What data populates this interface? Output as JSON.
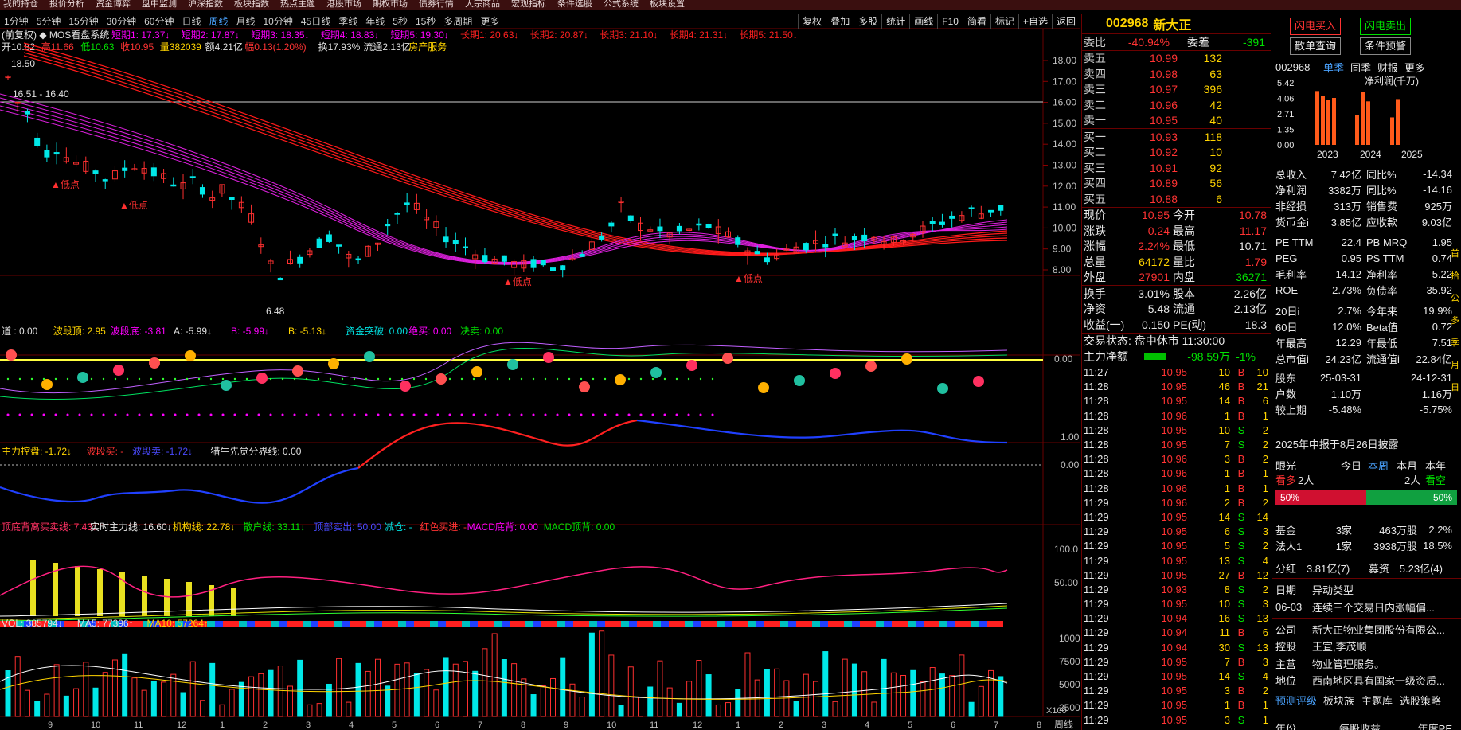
{
  "top_menu": [
    "我的持仓",
    "投价分析",
    "资金博弈",
    "盘中监测",
    "沪深指数",
    "板块指数",
    "热点主题",
    "港股市场",
    "期权市场",
    "债券行情",
    "大宗商品",
    "宏观指标",
    "条件选股",
    "公式系统",
    "板块设置"
  ],
  "periods": [
    "1分钟",
    "5分钟",
    "15分钟",
    "30分钟",
    "60分钟",
    "日线",
    "周线",
    "月线",
    "10分钟",
    "45日线",
    "季线",
    "年线",
    "5秒",
    "15秒",
    "多周期",
    "更多"
  ],
  "selected_period": "周线",
  "tools": [
    "复权",
    "叠加",
    "多股",
    "统计",
    "画线",
    "F10",
    "简看",
    "标记",
    "+自选",
    "返回"
  ],
  "chart": {
    "title_line": "(前复权) ◆ MOS看盘系统",
    "mas": [
      {
        "t": "短期1: 17.37↓",
        "c": "#ff00ff"
      },
      {
        "t": "短期2: 17.87↓",
        "c": "#ff00ff"
      },
      {
        "t": "短期3: 18.35↓",
        "c": "#ff00ff"
      },
      {
        "t": "短期4: 18.83↓",
        "c": "#ff00ff"
      },
      {
        "t": "短期5: 19.30↓",
        "c": "#ff00ff"
      },
      {
        "t": "长期1: 20.63↓",
        "c": "#ff2020"
      },
      {
        "t": "长期2: 20.87↓",
        "c": "#ff2020"
      },
      {
        "t": "长期3: 21.10↓",
        "c": "#ff2020"
      },
      {
        "t": "长期4: 21.31↓",
        "c": "#ff2020"
      },
      {
        "t": "长期5: 21.50↓",
        "c": "#ff2020"
      }
    ],
    "ohlc_line": [
      {
        "t": "开10.82 ",
        "c": "#e0e0e0"
      },
      {
        "t": "高11.66 ",
        "c": "#ff3333"
      },
      {
        "t": "低10.63 ",
        "c": "#00e000"
      },
      {
        "t": "收10.95 ",
        "c": "#ff3333"
      },
      {
        "t": "量382039 ",
        "c": "#ffd400"
      },
      {
        "t": "额4.21亿 ",
        "c": "#e0e0e0"
      },
      {
        "t": "幅0.13(1.20%) ",
        "c": "#ff3333"
      },
      {
        "t": "换17.93% ",
        "c": "#e0e0e0"
      },
      {
        "t": "流通2.13亿 ",
        "c": "#e0e0e0"
      },
      {
        "t": "房产服务",
        "c": "#ffd400"
      }
    ],
    "price_axis": [
      "18.00",
      "17.00",
      "16.00",
      "15.00",
      "14.00",
      "13.00",
      "12.00",
      "11.00",
      "10.00",
      "9.00",
      "8.00"
    ],
    "labels": {
      "high": "18.50",
      "range": "16.51 - 16.40",
      "low": "6.48",
      "dp1": "▲低点",
      "dp2": "▲低点",
      "dp3": "▲低点",
      "dp4": "▲低点",
      "dp5": "▲低点"
    },
    "ind1": [
      {
        "t": "道 : 0.00 ",
        "c": "#e0e0e0"
      },
      {
        "t": "波段顶: 2.95 ",
        "c": "#ffd400"
      },
      {
        "t": "波段底: -3.81 ",
        "c": "#ff00ff"
      },
      {
        "t": "A: -5.99↓ ",
        "c": "#e0e0e0"
      },
      {
        "t": "B: -5.99↓ ",
        "c": "#ff00ff"
      },
      {
        "t": "B: -5.13↓ ",
        "c": "#ffd400"
      },
      {
        "t": "资金突破: 0.00 ",
        "c": "#00e0e0"
      },
      {
        "t": "绝买: 0.00 ",
        "c": "#ff00ff"
      },
      {
        "t": "决卖: 0.00",
        "c": "#00e000"
      }
    ],
    "ind1_axis": "0.00",
    "ind2": [
      {
        "t": "主力控盘: -1.72↓ ",
        "c": "#ffd400"
      },
      {
        "t": "波段买: - ",
        "c": "#ff3333"
      },
      {
        "t": "波段卖: -1.72↓ ",
        "c": "#4a4aff"
      },
      {
        "t": "猎牛先觉分界线: 0.00",
        "c": "#e0e0e0"
      }
    ],
    "ind2_axis": [
      "1.00",
      "0.00"
    ],
    "ind3": [
      {
        "t": "顶底背离买卖线: 7.43↓ ",
        "c": "#ff3366"
      },
      {
        "t": "实时主力线: 16.60↓ ",
        "c": "#e8e8e8"
      },
      {
        "t": "机构线: 22.78↓ ",
        "c": "#ffd400"
      },
      {
        "t": "散户线: 33.11↓ ",
        "c": "#00e000"
      },
      {
        "t": "顶部卖出: 50.00 ",
        "c": "#4a4aff"
      },
      {
        "t": "减仓: - ",
        "c": "#00e0e0"
      },
      {
        "t": "红色买进: - ",
        "c": "#ff3333"
      },
      {
        "t": "MACD底背: 0.00 ",
        "c": "#ff00ff"
      },
      {
        "t": "MACD顶背: 0.00",
        "c": "#00e000"
      }
    ],
    "ind3_axis": [
      "100.0",
      "50.00"
    ],
    "vol": [
      {
        "t": "VOL: 385794↓ ",
        "c": "#e0e0e0"
      },
      {
        "t": "MA5: 77396↑ ",
        "c": "#e0e0e0"
      },
      {
        "t": "MA10: 57264↑",
        "c": "#ffd400"
      }
    ],
    "vol_axis": [
      "10000",
      "7500",
      "5000",
      "2500"
    ],
    "vol_unit": "X100",
    "xdates": [
      "9",
      "10",
      "11",
      "12",
      "1",
      "2",
      "3",
      "4",
      "5",
      "6",
      "7",
      "8",
      "9",
      "10",
      "11",
      "12",
      "1",
      "2",
      "3",
      "4",
      "5",
      "6",
      "7",
      "8"
    ],
    "x_label": "周线"
  },
  "quote": {
    "code": "002968",
    "name": "新大正",
    "wb": {
      "label": "委比",
      "val": "-40.94%",
      "label2": "委差",
      "val2": "-391"
    },
    "asks": [
      {
        "l": "卖五",
        "p": "10.99",
        "v": "132"
      },
      {
        "l": "卖四",
        "p": "10.98",
        "v": "63"
      },
      {
        "l": "卖三",
        "p": "10.97",
        "v": "396"
      },
      {
        "l": "卖二",
        "p": "10.96",
        "v": "42"
      },
      {
        "l": "卖一",
        "p": "10.95",
        "v": "40"
      }
    ],
    "bids": [
      {
        "l": "买一",
        "p": "10.93",
        "v": "118"
      },
      {
        "l": "买二",
        "p": "10.92",
        "v": "10"
      },
      {
        "l": "买三",
        "p": "10.91",
        "v": "92"
      },
      {
        "l": "买四",
        "p": "10.89",
        "v": "56"
      },
      {
        "l": "买五",
        "p": "10.88",
        "v": "6"
      }
    ],
    "stats": [
      [
        {
          "t": "现价",
          "c": "wht"
        },
        {
          "t": "10.95",
          "c": "red"
        },
        {
          "t": "今开",
          "c": "wht"
        },
        {
          "t": "10.78",
          "c": "red"
        }
      ],
      [
        {
          "t": "涨跌",
          "c": "wht"
        },
        {
          "t": "0.24",
          "c": "red"
        },
        {
          "t": "最高",
          "c": "wht"
        },
        {
          "t": "11.17",
          "c": "red"
        }
      ],
      [
        {
          "t": "涨幅",
          "c": "wht"
        },
        {
          "t": "2.24%",
          "c": "red"
        },
        {
          "t": "最低",
          "c": "wht"
        },
        {
          "t": "10.71",
          "c": "wht"
        }
      ],
      [
        {
          "t": "总量",
          "c": "wht"
        },
        {
          "t": "64172",
          "c": "yel"
        },
        {
          "t": "量比",
          "c": "wht"
        },
        {
          "t": "1.79",
          "c": "red"
        }
      ],
      [
        {
          "t": "外盘",
          "c": "wht"
        },
        {
          "t": "27901",
          "c": "red"
        },
        {
          "t": "内盘",
          "c": "wht"
        },
        {
          "t": "36271",
          "c": "grn"
        }
      ]
    ],
    "stats2": [
      [
        {
          "t": "换手",
          "c": "wht"
        },
        {
          "t": "3.01%",
          "c": "wht"
        },
        {
          "t": "股本",
          "c": "wht"
        },
        {
          "t": "2.26亿",
          "c": "wht"
        }
      ],
      [
        {
          "t": "净资",
          "c": "wht"
        },
        {
          "t": "5.48",
          "c": "wht"
        },
        {
          "t": "流通",
          "c": "wht"
        },
        {
          "t": "2.13亿",
          "c": "wht"
        }
      ],
      [
        {
          "t": "收益(一)",
          "c": "wht"
        },
        {
          "t": "0.150",
          "c": "wht"
        },
        {
          "t": "PE(动)",
          "c": "wht"
        },
        {
          "t": "18.3",
          "c": "wht"
        }
      ]
    ],
    "status": "交易状态: 盘中休市 11:30:00",
    "net": {
      "label": "主力净额",
      "val": "-98.59万",
      "pct": "-1%"
    },
    "trades": [
      {
        "t": "11:27",
        "p": "10.95",
        "v": "10",
        "d": "B",
        "n": "10"
      },
      {
        "t": "11:28",
        "p": "10.95",
        "v": "46",
        "d": "B",
        "n": "21"
      },
      {
        "t": "11:28",
        "p": "10.95",
        "v": "14",
        "d": "B",
        "n": "6"
      },
      {
        "t": "11:28",
        "p": "10.96",
        "v": "1",
        "d": "B",
        "n": "1"
      },
      {
        "t": "11:28",
        "p": "10.95",
        "v": "10",
        "d": "S",
        "n": "2"
      },
      {
        "t": "11:28",
        "p": "10.95",
        "v": "7",
        "d": "S",
        "n": "2"
      },
      {
        "t": "11:28",
        "p": "10.96",
        "v": "3",
        "d": "B",
        "n": "2"
      },
      {
        "t": "11:28",
        "p": "10.96",
        "v": "1",
        "d": "B",
        "n": "1"
      },
      {
        "t": "11:28",
        "p": "10.96",
        "v": "1",
        "d": "B",
        "n": "1"
      },
      {
        "t": "11:29",
        "p": "10.96",
        "v": "2",
        "d": "B",
        "n": "2"
      },
      {
        "t": "11:29",
        "p": "10.95",
        "v": "14",
        "d": "S",
        "n": "14"
      },
      {
        "t": "11:29",
        "p": "10.95",
        "v": "6",
        "d": "S",
        "n": "3"
      },
      {
        "t": "11:29",
        "p": "10.95",
        "v": "5",
        "d": "S",
        "n": "2"
      },
      {
        "t": "11:29",
        "p": "10.95",
        "v": "13",
        "d": "S",
        "n": "4"
      },
      {
        "t": "11:29",
        "p": "10.95",
        "v": "27",
        "d": "B",
        "n": "12"
      },
      {
        "t": "11:29",
        "p": "10.93",
        "v": "8",
        "d": "S",
        "n": "2"
      },
      {
        "t": "11:29",
        "p": "10.95",
        "v": "10",
        "d": "S",
        "n": "3"
      },
      {
        "t": "11:29",
        "p": "10.94",
        "v": "16",
        "d": "S",
        "n": "13"
      },
      {
        "t": "11:29",
        "p": "10.94",
        "v": "11",
        "d": "B",
        "n": "6"
      },
      {
        "t": "11:29",
        "p": "10.94",
        "v": "30",
        "d": "S",
        "n": "13"
      },
      {
        "t": "11:29",
        "p": "10.95",
        "v": "7",
        "d": "B",
        "n": "3"
      },
      {
        "t": "11:29",
        "p": "10.95",
        "v": "14",
        "d": "S",
        "n": "4"
      },
      {
        "t": "11:29",
        "p": "10.95",
        "v": "3",
        "d": "B",
        "n": "2"
      },
      {
        "t": "11:29",
        "p": "10.95",
        "v": "1",
        "d": "B",
        "n": "1"
      },
      {
        "t": "11:29",
        "p": "10.95",
        "v": "3",
        "d": "S",
        "n": "1"
      }
    ]
  },
  "f10": {
    "btns": [
      "闪电买入",
      "闪电卖出",
      "散单查询",
      "条件预警"
    ],
    "code": "002968",
    "tabs": [
      "单季",
      "同季",
      "财报",
      "更多"
    ],
    "chart_title": "净利润(千万)",
    "chart_data": {
      "type": "bar",
      "categories": [
        "2023",
        "2024",
        "2025"
      ],
      "yticks": [
        "5.42",
        "4.06",
        "2.71",
        "1.35",
        "0.00"
      ],
      "ylim": [
        0,
        5.42
      ],
      "values": [
        4.7,
        4.3,
        3.9,
        4.1,
        2.6,
        4.6,
        3.8,
        2.4,
        4.0
      ]
    },
    "fin": [
      [
        "总收入",
        "7.42亿",
        "同比%",
        "-14.34"
      ],
      [
        "净利润",
        "3382万",
        "同比%",
        "-14.16"
      ],
      [
        "非经损",
        "313万",
        "销售费",
        "925万"
      ],
      [
        "货币金i",
        "3.85亿",
        "应收款",
        "9.03亿"
      ],
      [
        "PE TTM",
        "22.4",
        "PB MRQ",
        "1.95"
      ],
      [
        "PEG",
        "0.95",
        "PS TTM",
        "0.74"
      ],
      [
        "毛利率",
        "14.12",
        "净利率",
        "5.22"
      ],
      [
        "ROE",
        "2.73%",
        "负债率",
        "35.92"
      ],
      [
        "20日i",
        "2.7%",
        "今年来",
        "19.9%"
      ],
      [
        "60日",
        "12.0%",
        "Beta值",
        "0.72"
      ],
      [
        "年最高",
        "12.29",
        "年最低",
        "7.51"
      ],
      [
        "总市值i",
        "24.23亿",
        "流通值i",
        "22.84亿"
      ],
      [
        "股东",
        "25-03-31",
        "",
        "24-12-31"
      ],
      [
        "户数",
        "1.10万",
        "",
        "1.16万"
      ],
      [
        "较上期",
        "-5.48%",
        "",
        "-5.75%"
      ]
    ],
    "report": "2025年中报于8月26日披露",
    "eye": {
      "label": "眼光",
      "tabs": [
        "今日",
        "本周",
        "本月",
        "本年"
      ],
      "bull": "看多",
      "bull_n": "2人",
      "bear_n": "2人",
      "bear": "看空",
      "bull_pct": "50%",
      "bear_pct": "50%"
    },
    "holders": [
      [
        "基金",
        "3家",
        "463万股",
        "2.2%"
      ],
      [
        "法人1",
        "1家",
        "3938万股",
        "18.5%"
      ]
    ],
    "div": [
      "分红",
      "3.81亿(7)",
      "募资",
      "5.23亿(4)"
    ],
    "events_head": [
      "日期",
      "异动类型"
    ],
    "event": [
      "06-03",
      "连续三个交易日内涨幅偏..."
    ],
    "info": [
      [
        "公司",
        "新大正物业集团股份有限公..."
      ],
      [
        "控股",
        "王宣,李茂顺"
      ],
      [
        "主营",
        "物业管理服务。"
      ],
      [
        "地位",
        "西南地区具有国家一级资质..."
      ]
    ],
    "bottom_tabs": [
      "预测评级",
      "板块族",
      "主题库",
      "选股策略"
    ],
    "last_row": [
      "年份",
      "每股收益",
      "年度PE"
    ],
    "side_icons": [
      "首",
      "拾",
      "公",
      "多",
      "季",
      "月",
      "日"
    ]
  }
}
